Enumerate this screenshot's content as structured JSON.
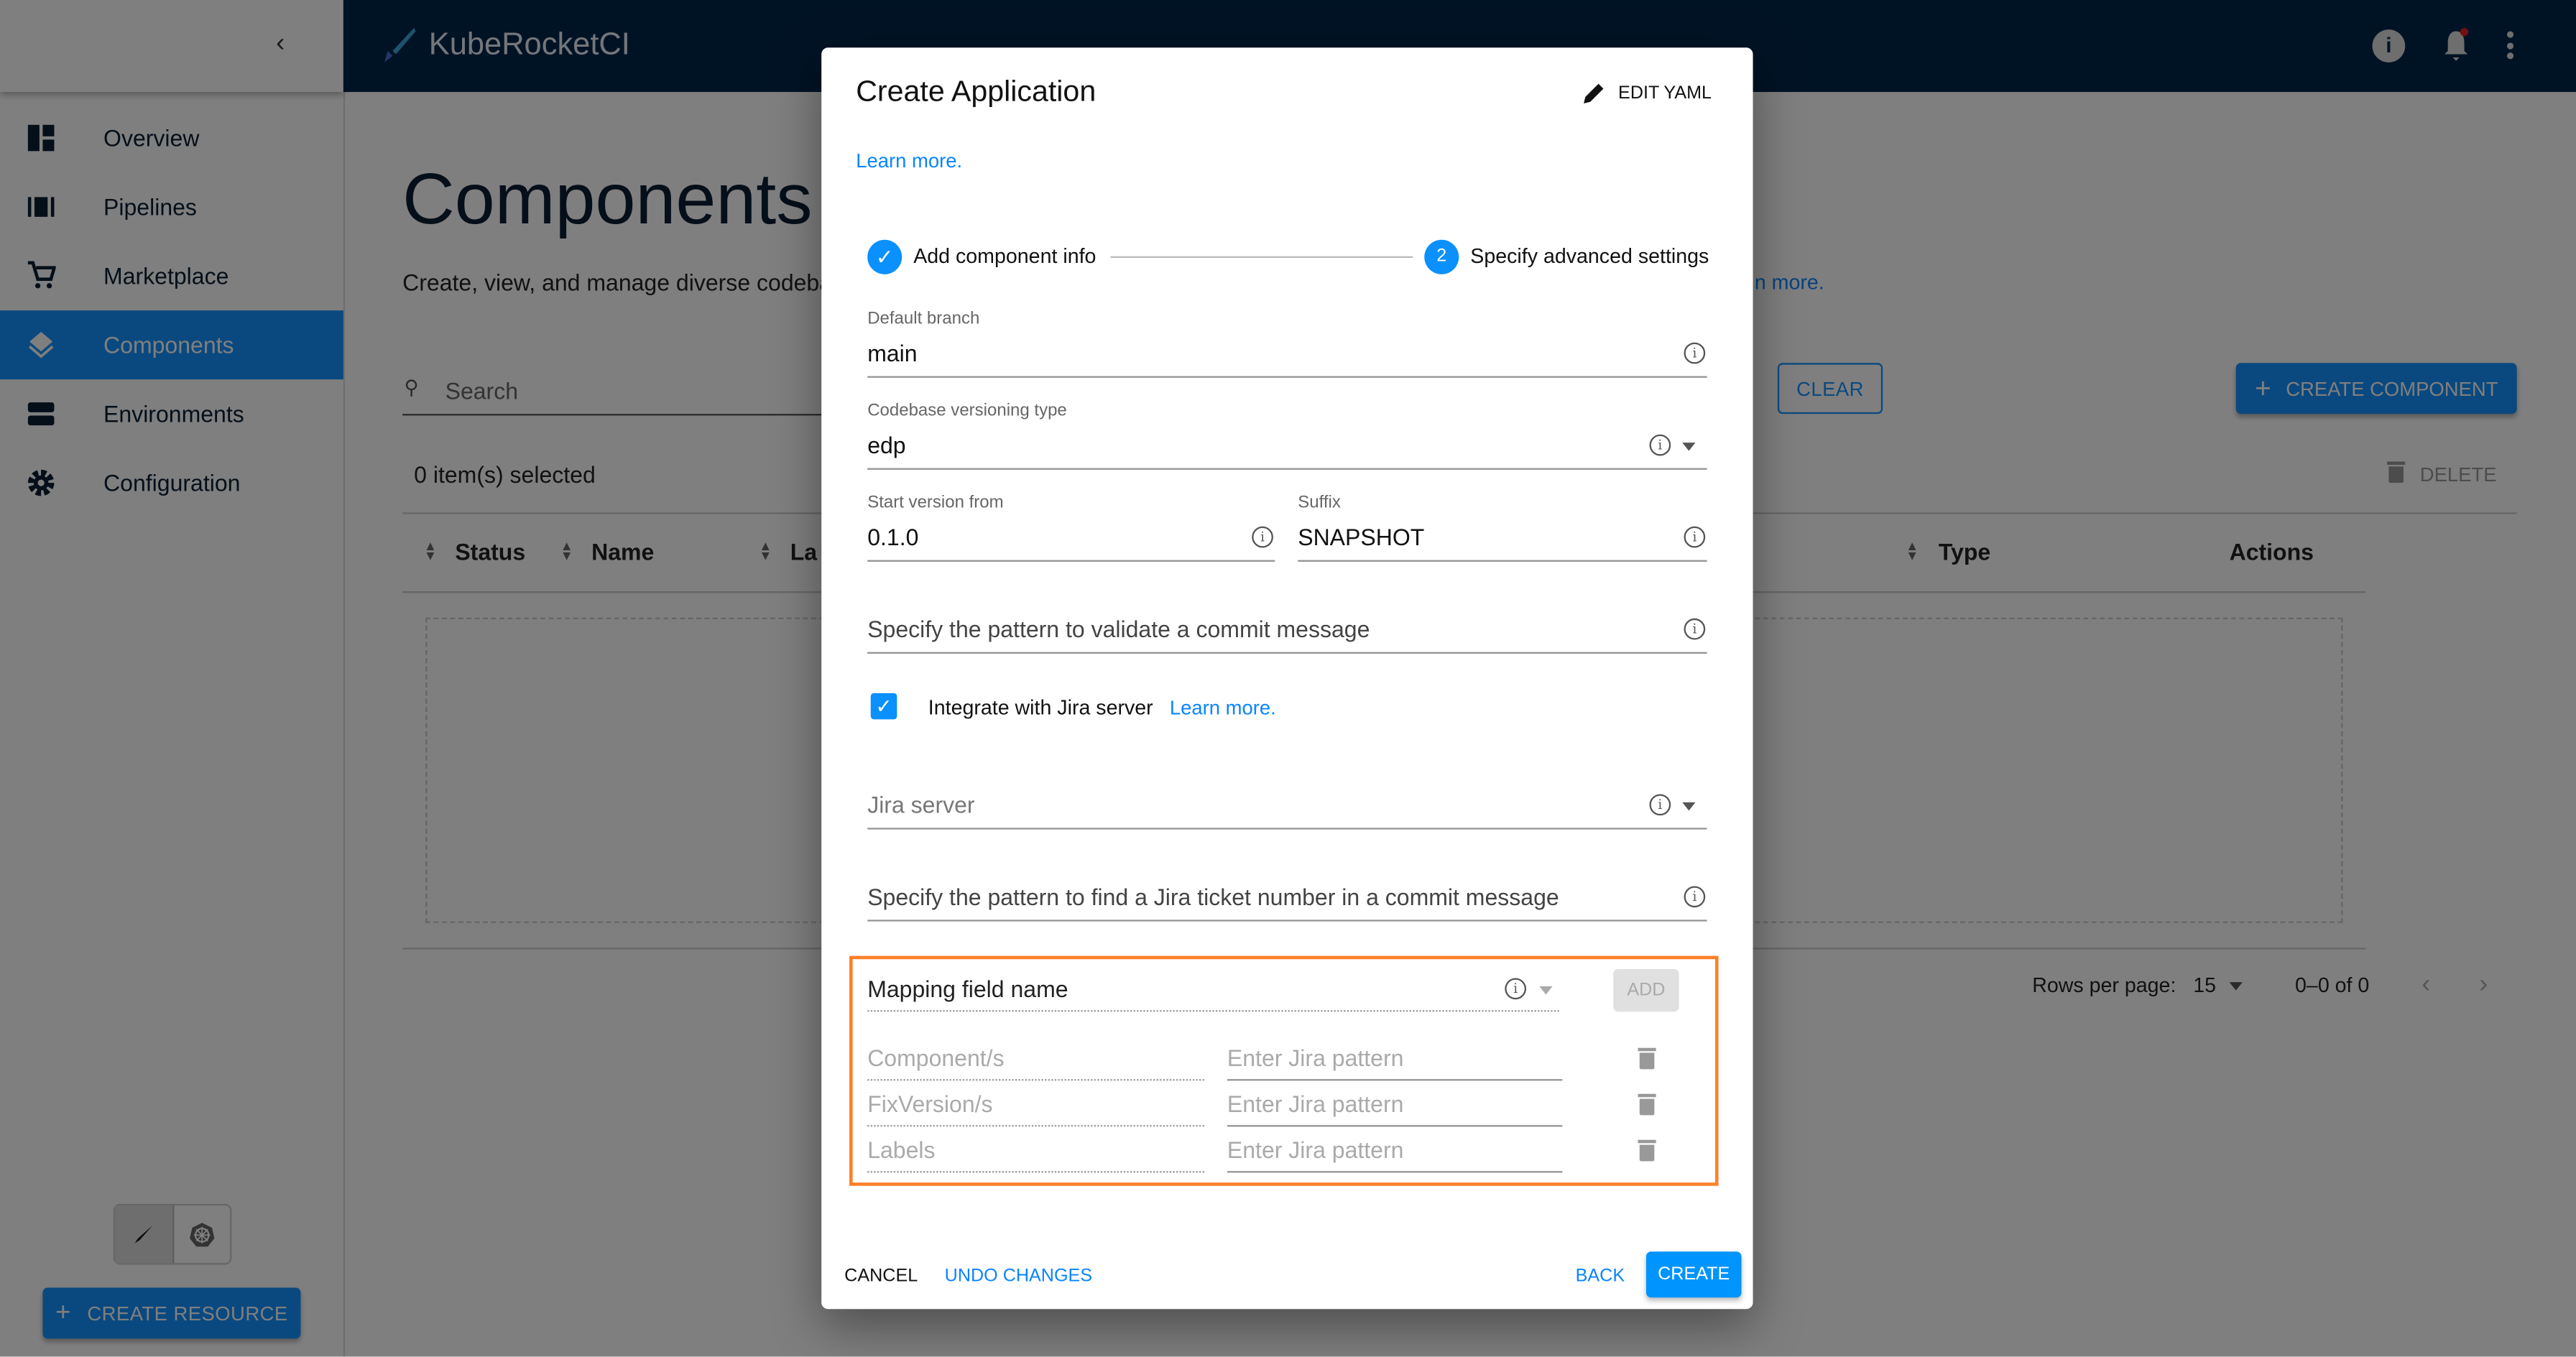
{
  "app": {
    "brand": "KubeRocketCI"
  },
  "sidebar": {
    "items": [
      {
        "label": "Overview",
        "icon": "dashboard-icon"
      },
      {
        "label": "Pipelines",
        "icon": "pipelines-icon"
      },
      {
        "label": "Marketplace",
        "icon": "cart-icon"
      },
      {
        "label": "Components",
        "icon": "layers-icon",
        "active": true
      },
      {
        "label": "Environments",
        "icon": "environments-icon"
      },
      {
        "label": "Configuration",
        "icon": "gear-icon"
      }
    ],
    "create_resource": "CREATE RESOURCE"
  },
  "page": {
    "title": "Components",
    "subtitle": "Create, view, and manage diverse codeba",
    "subtitle_link": "n more.",
    "search_placeholder": "Search",
    "clear": "CLEAR",
    "create_component": "CREATE COMPONENT",
    "selected": "0 item(s) selected",
    "delete": "DELETE",
    "columns": [
      "Status",
      "Name",
      "La",
      "Type",
      "Actions"
    ],
    "rows_per_page_label": "Rows per page:",
    "rows_per_page": "15",
    "range": "0–0 of 0"
  },
  "dialog": {
    "title": "Create Application",
    "edit_yaml": "EDIT YAML",
    "learn_more": "Learn more.",
    "steps": [
      {
        "label": "Add component info",
        "state": "completed"
      },
      {
        "number": "2",
        "label": "Specify advanced settings",
        "state": "active"
      }
    ],
    "default_branch": {
      "label": "Default branch",
      "value": "main"
    },
    "versioning": {
      "label": "Codebase versioning type",
      "value": "edp"
    },
    "start_version": {
      "label": "Start version from",
      "value": "0.1.0"
    },
    "suffix": {
      "label": "Suffix",
      "value": "SNAPSHOT"
    },
    "commit_pattern_placeholder": "Specify the pattern to validate a commit message",
    "jira_checkbox": {
      "label": "Integrate with Jira server",
      "checked": true,
      "link": "Learn more."
    },
    "jira_server_placeholder": "Jira server",
    "ticket_pattern_placeholder": "Specify the pattern to find a Jira ticket number in a commit message",
    "mapping": {
      "field_label": "Mapping field name",
      "add": "ADD",
      "rows": [
        {
          "field": "Component/s",
          "pattern_placeholder": "Enter Jira pattern"
        },
        {
          "field": "FixVersion/s",
          "pattern_placeholder": "Enter Jira pattern"
        },
        {
          "field": "Labels",
          "pattern_placeholder": "Enter Jira pattern"
        }
      ]
    },
    "footer": {
      "cancel": "CANCEL",
      "undo": "UNDO CHANGES",
      "back": "BACK",
      "create": "CREATE"
    }
  },
  "colors": {
    "accent": "#0094ff",
    "header": "#00264a",
    "highlight": "#ff7f27"
  }
}
